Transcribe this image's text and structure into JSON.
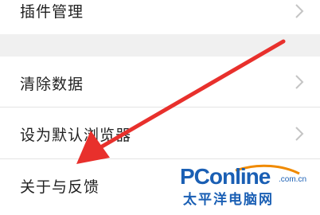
{
  "settings": {
    "items": [
      {
        "label": "插件管理"
      },
      {
        "label": "清除数据"
      },
      {
        "label": "设为默认浏览器"
      },
      {
        "label": "关于与反馈"
      }
    ]
  },
  "annotation": {
    "arrow_color": "#e8302c"
  },
  "watermark": {
    "brand": "PConline",
    "domain": ".com.cn",
    "name_cn": "太平洋电脑网",
    "brand_color": "#1a5fb4",
    "accent_color": "#f08a00"
  }
}
